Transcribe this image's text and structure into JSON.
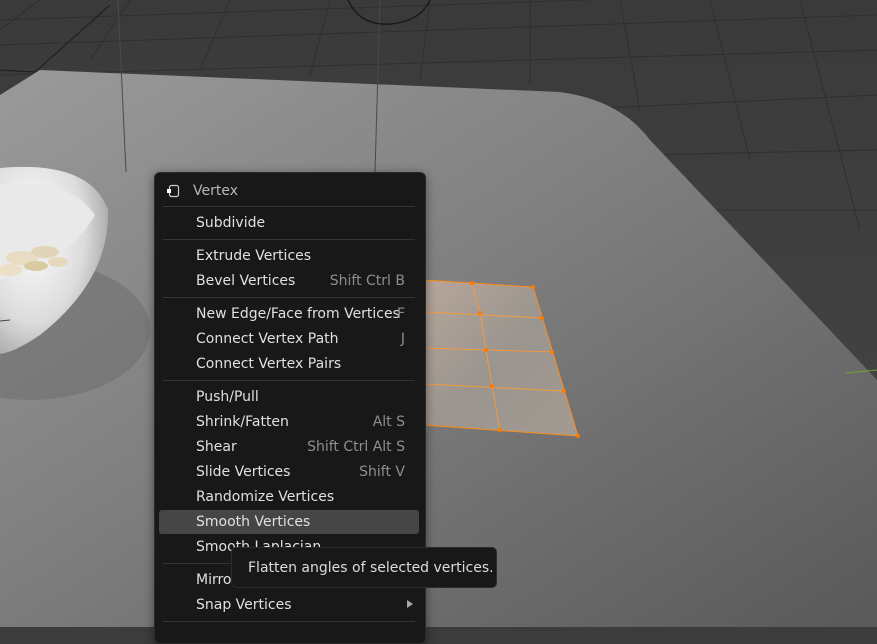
{
  "menu": {
    "title": "Vertex",
    "title_icon": "vertex-select-icon",
    "items": [
      {
        "label": "Subdivide",
        "shortcut": ""
      },
      {
        "label": "Extrude Vertices",
        "shortcut": ""
      },
      {
        "label": "Bevel Vertices",
        "shortcut": "Shift Ctrl B"
      },
      {
        "label": "New Edge/Face from Vertices",
        "shortcut": "F"
      },
      {
        "label": "Connect Vertex Path",
        "shortcut": "J"
      },
      {
        "label": "Connect Vertex Pairs",
        "shortcut": ""
      },
      {
        "label": "Push/Pull",
        "shortcut": ""
      },
      {
        "label": "Shrink/Fatten",
        "shortcut": "Alt S"
      },
      {
        "label": "Shear",
        "shortcut": "Shift Ctrl Alt S"
      },
      {
        "label": "Slide Vertices",
        "shortcut": "Shift V"
      },
      {
        "label": "Randomize Vertices",
        "shortcut": ""
      },
      {
        "label": "Smooth Vertices",
        "shortcut": ""
      },
      {
        "label": "Smooth Laplacian",
        "shortcut": ""
      },
      {
        "label": "Mirror",
        "shortcut": ""
      },
      {
        "label": "Snap Vertices",
        "shortcut": ""
      }
    ],
    "highlighted_item": "Smooth Vertices",
    "submenu_arrow_icon": "chevron-right-icon"
  },
  "tooltip": {
    "text": "Flatten angles of selected vertices."
  },
  "colors": {
    "menu_bg": "#181818",
    "highlight_bg": "#464646",
    "mesh_selection": "#ff8c1a",
    "floor": "#5a5a5a"
  }
}
